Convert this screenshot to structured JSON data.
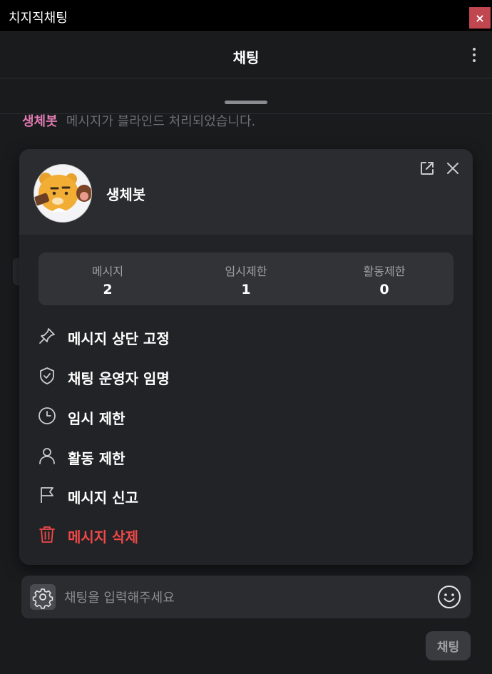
{
  "window": {
    "title": "치지직채팅",
    "close_label": "×"
  },
  "header": {
    "title": "채팅"
  },
  "background_message": {
    "nickname": "생체봇",
    "text": "메시지가 블라인드 처리되었습니다."
  },
  "profile": {
    "name": "생체봇",
    "avatar_icon": "ryan-character-avatar",
    "stats": [
      {
        "label": "메시지",
        "value": "2"
      },
      {
        "label": "임시제한",
        "value": "1"
      },
      {
        "label": "활동제한",
        "value": "0"
      }
    ],
    "menu": [
      {
        "label": "메시지 상단 고정",
        "icon": "pin-icon"
      },
      {
        "label": "채팅 운영자 임명",
        "icon": "shield-check-icon"
      },
      {
        "label": "임시 제한",
        "icon": "clock-icon"
      },
      {
        "label": "활동 제한",
        "icon": "user-icon"
      },
      {
        "label": "메시지 신고",
        "icon": "flag-icon"
      },
      {
        "label": "메시지 삭제",
        "icon": "trash-icon"
      }
    ]
  },
  "input": {
    "placeholder": "채팅을 입력해주세요",
    "value": ""
  },
  "send_button": {
    "label": "채팅"
  },
  "colors": {
    "background": "#1a1b1d",
    "popup": "#222326",
    "nickname": "#e07ab2",
    "danger": "#f04848",
    "close_button": "#c0464f"
  }
}
